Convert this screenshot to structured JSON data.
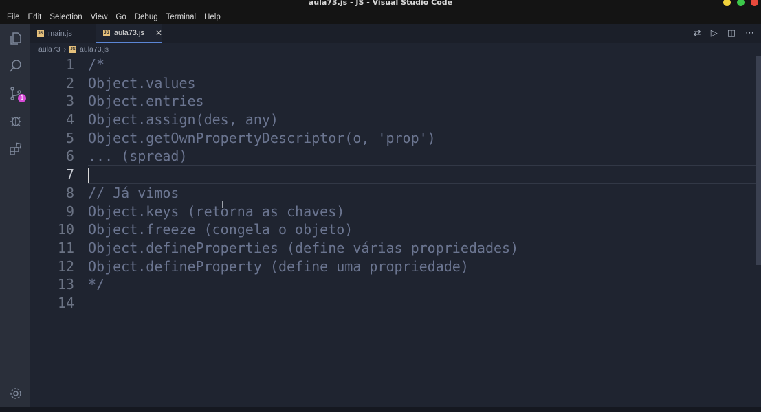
{
  "window": {
    "title": "aula73.js - JS - Visual Studio Code"
  },
  "menu": [
    "File",
    "Edit",
    "Selection",
    "View",
    "Go",
    "Debug",
    "Terminal",
    "Help"
  ],
  "activity_bar": {
    "items": [
      {
        "name": "explorer",
        "icon": "files-icon"
      },
      {
        "name": "search",
        "icon": "search-icon"
      },
      {
        "name": "source-control",
        "icon": "source-control-icon",
        "badge": "1"
      },
      {
        "name": "debug",
        "icon": "bug-icon"
      },
      {
        "name": "extensions",
        "icon": "extensions-icon"
      }
    ],
    "bottom_icon": "gear-icon",
    "badge_color": "#d84bd8"
  },
  "tabs": [
    {
      "label": "main.js",
      "active": false
    },
    {
      "label": "aula73.js",
      "active": true
    }
  ],
  "breadcrumb": {
    "folder": "aula73",
    "file": "aula73.js"
  },
  "editor": {
    "current_line": 7,
    "lines": [
      {
        "num": "1",
        "text": "/*"
      },
      {
        "num": "2",
        "text": "Object.values"
      },
      {
        "num": "3",
        "text": "Object.entries"
      },
      {
        "num": "4",
        "text": "Object.assign(des, any)"
      },
      {
        "num": "5",
        "text": "Object.getOwnPropertyDescriptor(o, 'prop')"
      },
      {
        "num": "6",
        "text": "... (spread)"
      },
      {
        "num": "7",
        "text": ""
      },
      {
        "num": "8",
        "text": "// Já vimos"
      },
      {
        "num": "9",
        "text": "Object.keys (retorna as chaves)"
      },
      {
        "num": "10",
        "text": "Object.freeze (congela o objeto)"
      },
      {
        "num": "11",
        "text": "Object.defineProperties (define várias propriedades)"
      },
      {
        "num": "12",
        "text": "Object.defineProperty (define uma propriedade)"
      },
      {
        "num": "13",
        "text": "*/"
      },
      {
        "num": "14",
        "text": ""
      }
    ]
  }
}
